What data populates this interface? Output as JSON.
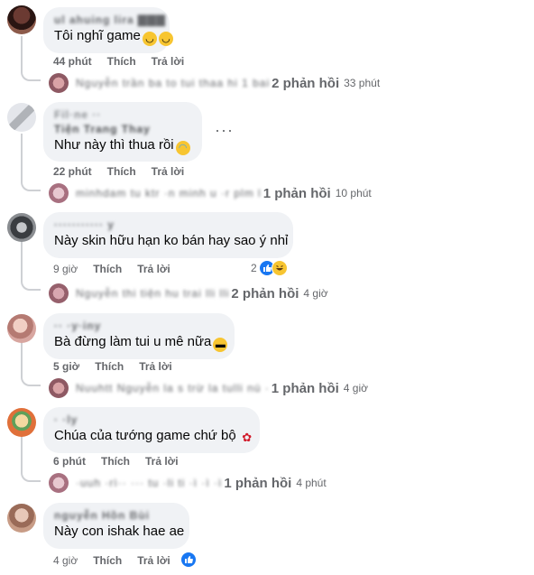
{
  "colors": {
    "bubble": "#f0f2f5",
    "meta": "#65676b",
    "like": "#1877f2",
    "thread": "#ced0d4"
  },
  "action_labels": {
    "like": "Thích",
    "reply": "Trả lời"
  },
  "comments": [
    {
      "name_blur": "ul ahuing lira  ▇▇▇",
      "text": "Tôi nghĩ game",
      "emojis": [
        "slightly-smiling-face",
        "slightly-smiling-face"
      ],
      "time": "44 phút",
      "reply_preview_blur": "Nguyễn trần ba to tui thaa hi 1 bai",
      "reply_count": "2 phản hồi",
      "reply_time": "33 phút"
    },
    {
      "name_blur": "Fil·ne ··",
      "subname_blur": "Tiện Trang Thay",
      "text": "Như này thì thua rồi",
      "emojis": [
        "sad-tears-face"
      ],
      "more": "···",
      "time": "22 phút",
      "reply_preview_blur": "minhdam tu ktr ·n minh u ·r plm l",
      "reply_count": "1 phản hồi",
      "reply_time": "10 phút"
    },
    {
      "name_blur": "··········· y",
      "text": "Này skin hữu hạn ko bán hay sao ý nhỉ",
      "emojis": [],
      "time": "9 giờ",
      "reaction_count": "2",
      "reaction_icons": [
        "like-icon",
        "haha-icon"
      ],
      "reply_preview_blur": "Nguyễn thi tiện hu trai lli lli",
      "reply_count": "2 phản hồi",
      "reply_time": "4 giờ"
    },
    {
      "name_blur": "·· ·y·iny",
      "text": "Bà đừng làm tui u mê nữa",
      "emojis": [
        "grinning-face"
      ],
      "time": "5 giờ",
      "reply_preview_blur": "Nuuhtt Nguyễn la s trừ la tulli nú ·",
      "reply_count": "1 phản hồi",
      "reply_time": "4 giờ"
    },
    {
      "name_blur": "· ·ly",
      "text": "Chúa của tướng game chứ bộ",
      "emojis": [
        "rose"
      ],
      "time": "6 phút",
      "reply_preview_blur": "·uuh ·rì·· ··· tu ·li ti ·ì ·ì ·ì",
      "reply_count": "1 phản hồi",
      "reply_time": "4 phút"
    },
    {
      "name_blur": "nguyễn Hồn Bùi",
      "text": "Này con ishak hae ae",
      "emojis": [],
      "time": "4 giờ",
      "reaction_icons": [
        "like-icon"
      ]
    }
  ]
}
